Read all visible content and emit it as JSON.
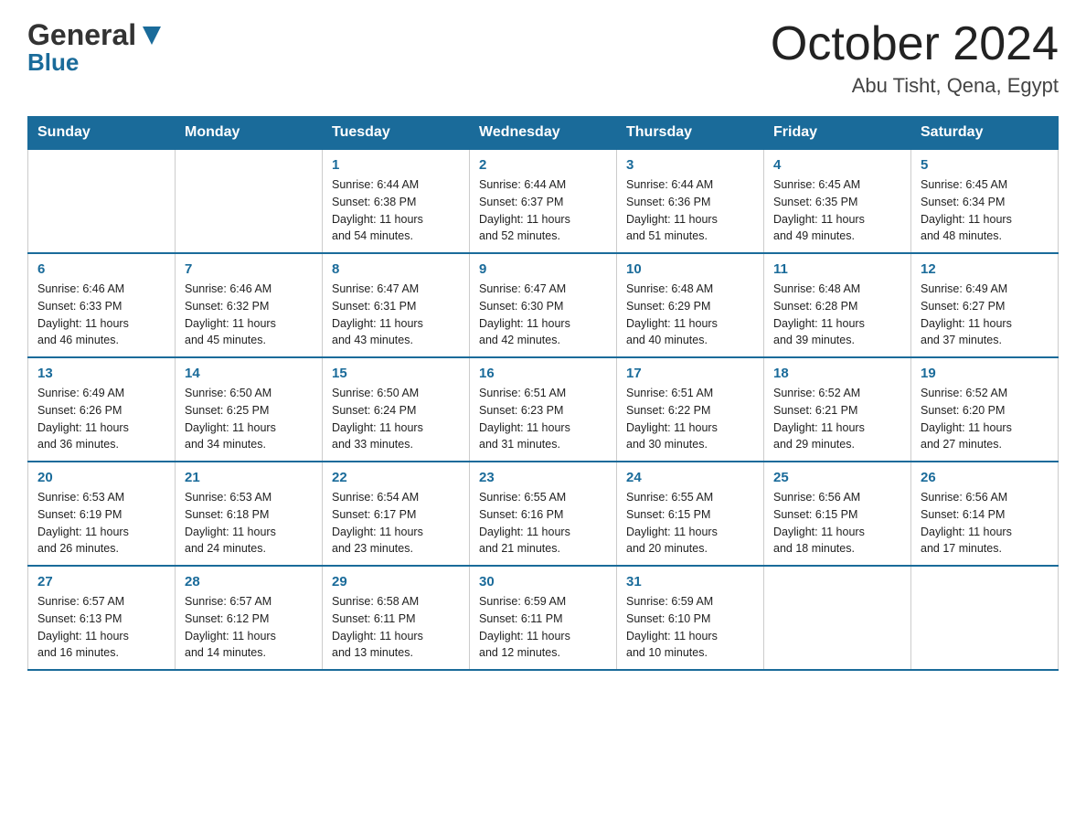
{
  "logo": {
    "general": "General",
    "blue": "Blue"
  },
  "title": "October 2024",
  "location": "Abu Tisht, Qena, Egypt",
  "days_of_week": [
    "Sunday",
    "Monday",
    "Tuesday",
    "Wednesday",
    "Thursday",
    "Friday",
    "Saturday"
  ],
  "weeks": [
    [
      {
        "day": "",
        "info": ""
      },
      {
        "day": "",
        "info": ""
      },
      {
        "day": "1",
        "info": "Sunrise: 6:44 AM\nSunset: 6:38 PM\nDaylight: 11 hours\nand 54 minutes."
      },
      {
        "day": "2",
        "info": "Sunrise: 6:44 AM\nSunset: 6:37 PM\nDaylight: 11 hours\nand 52 minutes."
      },
      {
        "day": "3",
        "info": "Sunrise: 6:44 AM\nSunset: 6:36 PM\nDaylight: 11 hours\nand 51 minutes."
      },
      {
        "day": "4",
        "info": "Sunrise: 6:45 AM\nSunset: 6:35 PM\nDaylight: 11 hours\nand 49 minutes."
      },
      {
        "day": "5",
        "info": "Sunrise: 6:45 AM\nSunset: 6:34 PM\nDaylight: 11 hours\nand 48 minutes."
      }
    ],
    [
      {
        "day": "6",
        "info": "Sunrise: 6:46 AM\nSunset: 6:33 PM\nDaylight: 11 hours\nand 46 minutes."
      },
      {
        "day": "7",
        "info": "Sunrise: 6:46 AM\nSunset: 6:32 PM\nDaylight: 11 hours\nand 45 minutes."
      },
      {
        "day": "8",
        "info": "Sunrise: 6:47 AM\nSunset: 6:31 PM\nDaylight: 11 hours\nand 43 minutes."
      },
      {
        "day": "9",
        "info": "Sunrise: 6:47 AM\nSunset: 6:30 PM\nDaylight: 11 hours\nand 42 minutes."
      },
      {
        "day": "10",
        "info": "Sunrise: 6:48 AM\nSunset: 6:29 PM\nDaylight: 11 hours\nand 40 minutes."
      },
      {
        "day": "11",
        "info": "Sunrise: 6:48 AM\nSunset: 6:28 PM\nDaylight: 11 hours\nand 39 minutes."
      },
      {
        "day": "12",
        "info": "Sunrise: 6:49 AM\nSunset: 6:27 PM\nDaylight: 11 hours\nand 37 minutes."
      }
    ],
    [
      {
        "day": "13",
        "info": "Sunrise: 6:49 AM\nSunset: 6:26 PM\nDaylight: 11 hours\nand 36 minutes."
      },
      {
        "day": "14",
        "info": "Sunrise: 6:50 AM\nSunset: 6:25 PM\nDaylight: 11 hours\nand 34 minutes."
      },
      {
        "day": "15",
        "info": "Sunrise: 6:50 AM\nSunset: 6:24 PM\nDaylight: 11 hours\nand 33 minutes."
      },
      {
        "day": "16",
        "info": "Sunrise: 6:51 AM\nSunset: 6:23 PM\nDaylight: 11 hours\nand 31 minutes."
      },
      {
        "day": "17",
        "info": "Sunrise: 6:51 AM\nSunset: 6:22 PM\nDaylight: 11 hours\nand 30 minutes."
      },
      {
        "day": "18",
        "info": "Sunrise: 6:52 AM\nSunset: 6:21 PM\nDaylight: 11 hours\nand 29 minutes."
      },
      {
        "day": "19",
        "info": "Sunrise: 6:52 AM\nSunset: 6:20 PM\nDaylight: 11 hours\nand 27 minutes."
      }
    ],
    [
      {
        "day": "20",
        "info": "Sunrise: 6:53 AM\nSunset: 6:19 PM\nDaylight: 11 hours\nand 26 minutes."
      },
      {
        "day": "21",
        "info": "Sunrise: 6:53 AM\nSunset: 6:18 PM\nDaylight: 11 hours\nand 24 minutes."
      },
      {
        "day": "22",
        "info": "Sunrise: 6:54 AM\nSunset: 6:17 PM\nDaylight: 11 hours\nand 23 minutes."
      },
      {
        "day": "23",
        "info": "Sunrise: 6:55 AM\nSunset: 6:16 PM\nDaylight: 11 hours\nand 21 minutes."
      },
      {
        "day": "24",
        "info": "Sunrise: 6:55 AM\nSunset: 6:15 PM\nDaylight: 11 hours\nand 20 minutes."
      },
      {
        "day": "25",
        "info": "Sunrise: 6:56 AM\nSunset: 6:15 PM\nDaylight: 11 hours\nand 18 minutes."
      },
      {
        "day": "26",
        "info": "Sunrise: 6:56 AM\nSunset: 6:14 PM\nDaylight: 11 hours\nand 17 minutes."
      }
    ],
    [
      {
        "day": "27",
        "info": "Sunrise: 6:57 AM\nSunset: 6:13 PM\nDaylight: 11 hours\nand 16 minutes."
      },
      {
        "day": "28",
        "info": "Sunrise: 6:57 AM\nSunset: 6:12 PM\nDaylight: 11 hours\nand 14 minutes."
      },
      {
        "day": "29",
        "info": "Sunrise: 6:58 AM\nSunset: 6:11 PM\nDaylight: 11 hours\nand 13 minutes."
      },
      {
        "day": "30",
        "info": "Sunrise: 6:59 AM\nSunset: 6:11 PM\nDaylight: 11 hours\nand 12 minutes."
      },
      {
        "day": "31",
        "info": "Sunrise: 6:59 AM\nSunset: 6:10 PM\nDaylight: 11 hours\nand 10 minutes."
      },
      {
        "day": "",
        "info": ""
      },
      {
        "day": "",
        "info": ""
      }
    ]
  ]
}
